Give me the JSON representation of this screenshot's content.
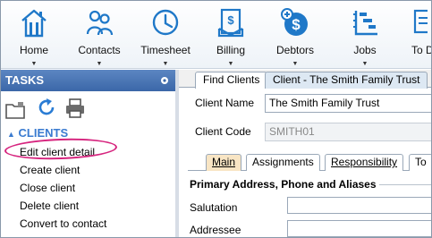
{
  "toolbar": {
    "items": [
      {
        "label": "Home",
        "icon": "house-icon"
      },
      {
        "label": "Contacts",
        "icon": "people-icon"
      },
      {
        "label": "Timesheet",
        "icon": "clock-icon"
      },
      {
        "label": "Billing",
        "icon": "invoice-icon"
      },
      {
        "label": "Debtors",
        "icon": "dollar-coin-icon"
      },
      {
        "label": "Jobs",
        "icon": "jobs-list-icon"
      },
      {
        "label": "To D",
        "icon": "todo-icon"
      }
    ],
    "accent": "#1f78c8"
  },
  "tasks": {
    "header": "TASKS",
    "section_title": "CLIENTS",
    "items": [
      "Edit client detail",
      "Create client",
      "Close client",
      "Delete client",
      "Convert to contact"
    ],
    "highlight_color": "#d6247e"
  },
  "tabs": [
    "Find Clients",
    "Client - The Smith Family Trust"
  ],
  "client": {
    "name_label": "Client Name",
    "name_value": "The Smith Family Trust",
    "code_label": "Client Code",
    "code_value": "SMITH01"
  },
  "subtabs": [
    "Main",
    "Assignments",
    "Responsibility",
    "To"
  ],
  "main": {
    "group_title": "Primary Address, Phone and Aliases",
    "fields": [
      "Salutation",
      "Addressee"
    ]
  }
}
